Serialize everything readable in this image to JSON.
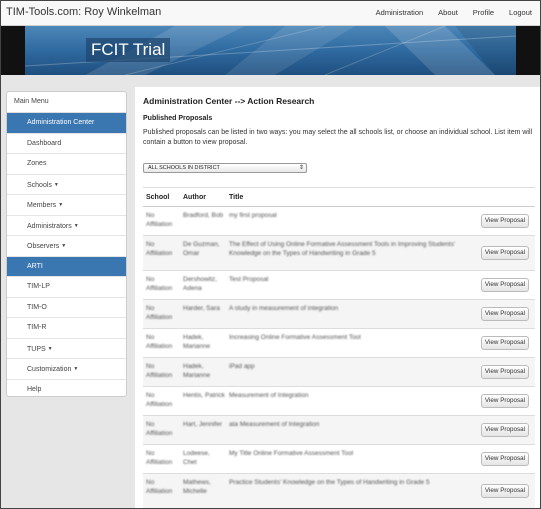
{
  "navbar": {
    "brand": "TIM-Tools.com: Roy Winkelman",
    "links": [
      "Administration",
      "About",
      "Profile",
      "Logout"
    ]
  },
  "banner": {
    "title": "FCIT Trial"
  },
  "sidebar": {
    "title": "Main Menu",
    "items": [
      {
        "label": "Administration Center",
        "active": true,
        "caret": false
      },
      {
        "label": "Dashboard",
        "active": false,
        "caret": false
      },
      {
        "label": "Zones",
        "active": false,
        "caret": false
      },
      {
        "label": "Schools",
        "active": false,
        "caret": true
      },
      {
        "label": "Members",
        "active": false,
        "caret": true
      },
      {
        "label": "Administrators",
        "active": false,
        "caret": true
      },
      {
        "label": "Observers",
        "active": false,
        "caret": true
      },
      {
        "label": "ARTI",
        "active": true,
        "caret": false
      },
      {
        "label": "TIM-LP",
        "active": false,
        "caret": false
      },
      {
        "label": "TIM-O",
        "active": false,
        "caret": false
      },
      {
        "label": "TIM-R",
        "active": false,
        "caret": false
      },
      {
        "label": "TUPS",
        "active": false,
        "caret": true
      },
      {
        "label": "Customization",
        "active": false,
        "caret": true
      },
      {
        "label": "Help",
        "active": false,
        "caret": false
      }
    ]
  },
  "main": {
    "title": "Administration Center --> Action Research",
    "section_title": "Published Proposals",
    "description": "Published proposals can be listed in two ways: you may select the all schools list, or choose an individual school. List item will contain a button to view proposal.",
    "select_value": "ALL SCHOOLS IN DISTRICT",
    "table": {
      "headers": [
        "School",
        "Author",
        "Title"
      ],
      "button_label": "View Proposal",
      "rows": [
        {
          "school": "No Affiliation",
          "author": "Bradford, Bob",
          "title": "my first proposal"
        },
        {
          "school": "No Affiliation",
          "author": "De Guzman, Omar",
          "title": "The Effect of Using Online Formative Assessment Tools in Improving Students' Knowledge on the Types of Handwriting in Grade 5"
        },
        {
          "school": "No Affiliation",
          "author": "Dershowitz, Adena",
          "title": "Test Proposal"
        },
        {
          "school": "No Affiliation",
          "author": "Harder, Sara",
          "title": "A study in measurement of integration"
        },
        {
          "school": "No Affiliation",
          "author": "Hadek, Marianne",
          "title": "Increasing Online Formative Assessment Tool"
        },
        {
          "school": "No Affiliation",
          "author": "Hadek, Marianne",
          "title": "iPad app"
        },
        {
          "school": "No Affiliation",
          "author": "Hentis, Patrick",
          "title": "Measurement of Integration"
        },
        {
          "school": "No Affiliation",
          "author": "Hart, Jennifer",
          "title": "ata Measurement of Integration"
        },
        {
          "school": "No Affiliation",
          "author": "Lodeese, Chet",
          "title": "My Title Online Formative Assessment Tool"
        },
        {
          "school": "No Affiliation",
          "author": "Mathews, Michelle",
          "title": "Practice Students' Knowledge on the Types of Handwriting in Grade 5"
        }
      ]
    }
  }
}
